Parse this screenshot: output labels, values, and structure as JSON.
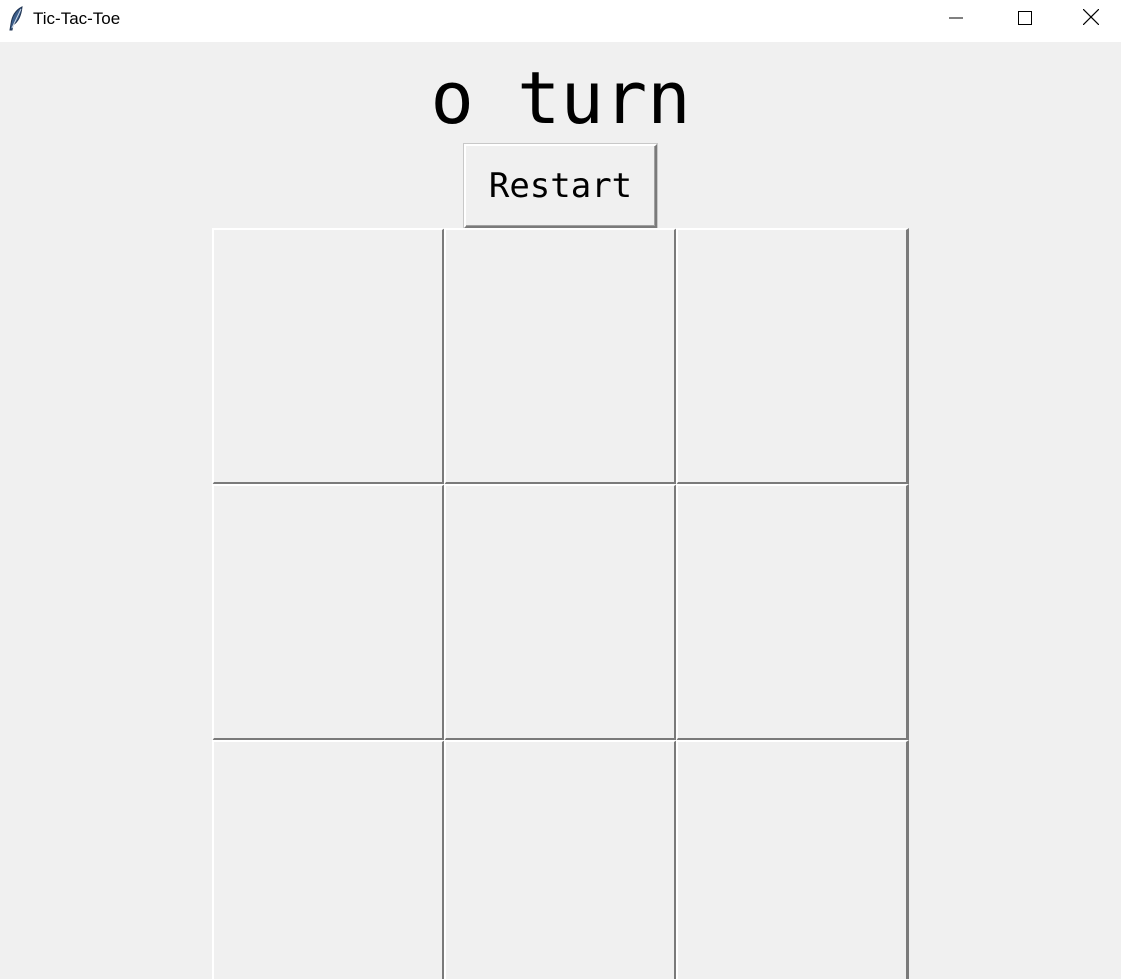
{
  "window": {
    "title": "Tic-Tac-Toe",
    "app_icon": "feather-icon",
    "controls": [
      "minimize-icon",
      "maximize-icon",
      "close-icon"
    ]
  },
  "game": {
    "status": "o turn",
    "restart_label": "Restart",
    "board": [
      [
        "",
        "",
        ""
      ],
      [
        "",
        "",
        ""
      ],
      [
        "",
        "",
        ""
      ]
    ]
  },
  "colors": {
    "background": "#f0f0f0",
    "titlebar": "#ffffff",
    "cell_shadow": "#7a7a7a",
    "text": "#000000"
  }
}
